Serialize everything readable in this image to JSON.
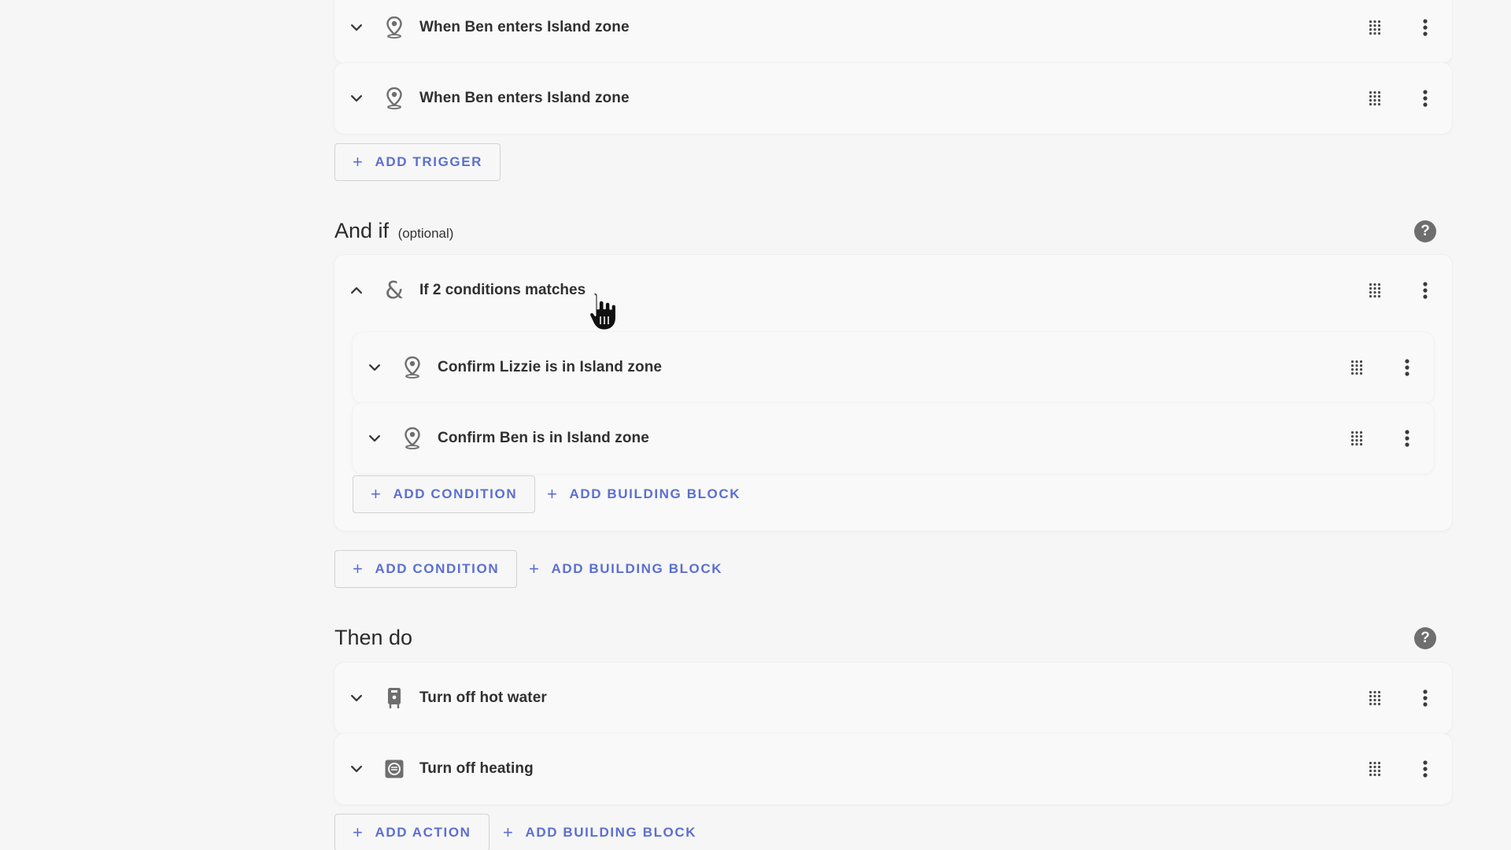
{
  "triggers": {
    "items": [
      {
        "label": "When Ben enters Island zone",
        "icon": "map-marker-icon"
      },
      {
        "label": "When Ben enters Island zone",
        "icon": "map-marker-icon"
      }
    ],
    "add_trigger_label": "ADD TRIGGER"
  },
  "conditions_section": {
    "title": "And if",
    "optional": "(optional)",
    "group": {
      "label": "If 2 conditions matches",
      "icon": "ampersand-icon",
      "items": [
        {
          "label": "Confirm Lizzie is in Island zone",
          "icon": "map-marker-icon"
        },
        {
          "label": "Confirm Ben is in Island zone",
          "icon": "map-marker-icon"
        }
      ],
      "add_condition_label": "ADD CONDITION",
      "add_building_block_label": "ADD BUILDING BLOCK"
    },
    "add_condition_label": "ADD CONDITION",
    "add_building_block_label": "ADD BUILDING BLOCK"
  },
  "actions_section": {
    "title": "Then do",
    "items": [
      {
        "label": "Turn off hot water",
        "icon": "water-boiler-icon"
      },
      {
        "label": "Turn off heating",
        "icon": "thermostat-icon"
      }
    ],
    "add_action_label": "ADD ACTION",
    "add_building_block_label": "ADD BUILDING BLOCK"
  },
  "help_icon": "?",
  "colors": {
    "accent": "#5b6fd1",
    "background": "#f6f6f6",
    "card": "#f9f9f9",
    "icon_gray": "#6e6e6e"
  }
}
